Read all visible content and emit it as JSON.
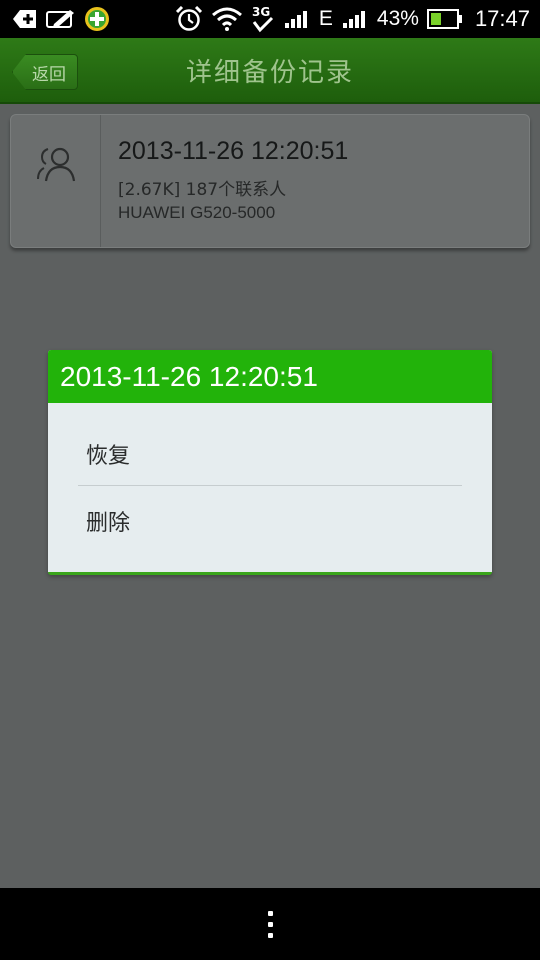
{
  "status_bar": {
    "icons_left": [
      "add-notification-icon",
      "edit-icon",
      "app-store-icon"
    ],
    "icons_right": [
      "alarm-icon",
      "wifi-icon",
      "3g-data-icon",
      "signal-icon",
      "signal-2-icon"
    ],
    "network_label": "E",
    "battery_percent": "43%",
    "battery_level": 0.43,
    "time": "17:47"
  },
  "title_bar": {
    "back_label": "返回",
    "title": "详细备份记录"
  },
  "record": {
    "icon": "contacts-icon",
    "time": "2013-11-26 12:20:51",
    "size_info": "[2.67K] 187个联系人",
    "device": "HUAWEI G520-5000"
  },
  "dialog": {
    "title": "2013-11-26 12:20:51",
    "options": [
      "恢复",
      "删除"
    ]
  },
  "nav_bar": {
    "icon": "menu-icon"
  },
  "colors": {
    "title_bar": "#1f620e",
    "dialog_header": "#22b30a",
    "dialog_body": "#e6edef",
    "dim_background": "#5d6060"
  }
}
